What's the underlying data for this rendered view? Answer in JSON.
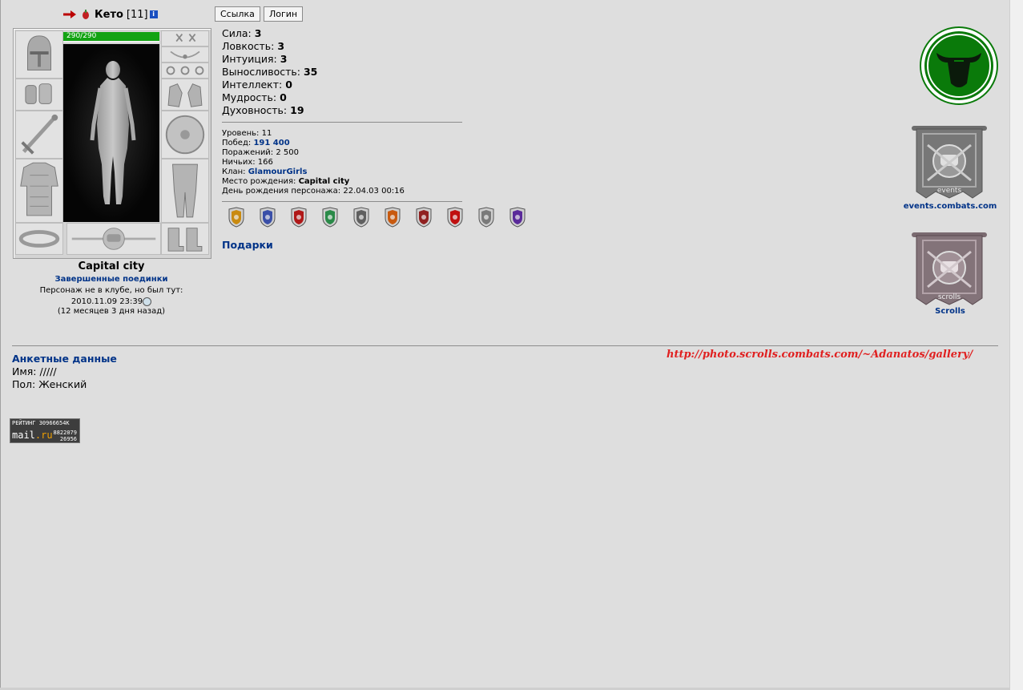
{
  "header": {
    "nick": "Кето",
    "level": "[11]",
    "info_icon": "i",
    "buttons": {
      "link": "Ссылка",
      "login": "Логин"
    }
  },
  "character": {
    "hp": "290/290",
    "city": "Capital city",
    "battles_link": "Завершенные поединки",
    "not_in_club": "Персонаж не в клубе, но был тут:",
    "last_seen": "2010.11.09 23:39",
    "ago": "(12 месяцев 3 дня назад)"
  },
  "stats": [
    {
      "label": "Сила:",
      "value": "3"
    },
    {
      "label": "Ловкость:",
      "value": "3"
    },
    {
      "label": "Интуиция:",
      "value": "3"
    },
    {
      "label": "Выносливость:",
      "value": "35"
    },
    {
      "label": "Интеллект:",
      "value": "0"
    },
    {
      "label": "Мудрость:",
      "value": "0"
    },
    {
      "label": "Духовность:",
      "value": "19"
    }
  ],
  "info": {
    "level_label": "Уровень:",
    "level_value": "11",
    "wins_label": "Побед:",
    "wins_value": "191 400",
    "losses_label": "Поражений:",
    "losses_value": "2 500",
    "draws_label": "Ничьих:",
    "draws_value": "166",
    "clan_label": "Клан:",
    "clan_value": "GlamourGirls",
    "birthplace_label": "Место рождения:",
    "birthplace_value": "Capital city",
    "birthday_label": "День рождения персонажа:",
    "birthday_value": "22.04.03 00:16"
  },
  "badge_colors": [
    "#c98a10",
    "#3a4fa8",
    "#b01818",
    "#2a8a48",
    "#606060",
    "#c85a10",
    "#902020",
    "#c01010",
    "#7a7a7a",
    "#5a2a9a"
  ],
  "gifts": "Подарки",
  "right": {
    "events_label": "events.combats.com",
    "events_banner_text": "events",
    "scrolls_label": "Scrolls",
    "scrolls_banner_text": "scrolls"
  },
  "profile": {
    "title": "Анкетные данные",
    "name": "Имя: /////",
    "sex": "Пол: Женский",
    "gallery": "http://photo.scrolls.combats.com/~Adanatos/gallery/"
  },
  "counter": {
    "top": "РЕЙТИНГ 30966654К",
    "brand_a": "mail",
    "brand_b": ".ru",
    "n1": "8822079",
    "n2": "26956"
  },
  "colors": {
    "link": "#003388",
    "hp": "#13a313",
    "emblem": "#0a7a0a",
    "gallery": "#e02020"
  }
}
